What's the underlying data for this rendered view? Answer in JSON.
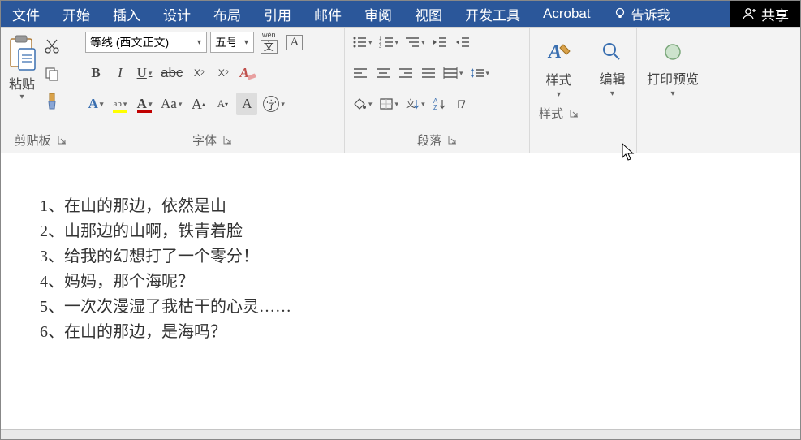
{
  "menubar": {
    "tabs": [
      "文件",
      "开始",
      "插入",
      "设计",
      "布局",
      "引用",
      "邮件",
      "审阅",
      "视图",
      "开发工具",
      "Acrobat"
    ],
    "active_index": 1,
    "tell_me": "告诉我",
    "share": "共享"
  },
  "ribbon": {
    "clipboard": {
      "label": "剪贴板",
      "paste": "粘贴"
    },
    "font": {
      "label": "字体",
      "font_name": "等线 (西文正文)",
      "font_size": "五号",
      "phonetic_top": "wén",
      "phonetic_bottom": "文",
      "char_box": "A",
      "bold": "B",
      "italic": "I",
      "underline": "U",
      "strike": "abc",
      "sub": "X",
      "subn": "2",
      "sup": "X",
      "supn": "2",
      "grow": "A",
      "shrink": "A",
      "Aa": "Aa",
      "clearfmt": "A"
    },
    "paragraph": {
      "label": "段落"
    },
    "styles": {
      "label": "样式",
      "btn": "样式"
    },
    "edit": {
      "label": "",
      "btn": "编辑"
    },
    "print_preview": {
      "label": "",
      "btn": "打印预览"
    }
  },
  "document": {
    "lines": [
      "1、在山的那边，依然是山",
      "2、山那边的山啊，铁青着脸",
      "3、给我的幻想打了一个零分！",
      "4、妈妈，那个海呢？",
      "5、一次次漫湿了我枯干的心灵……",
      "6、在山的那边，是海吗？"
    ]
  }
}
